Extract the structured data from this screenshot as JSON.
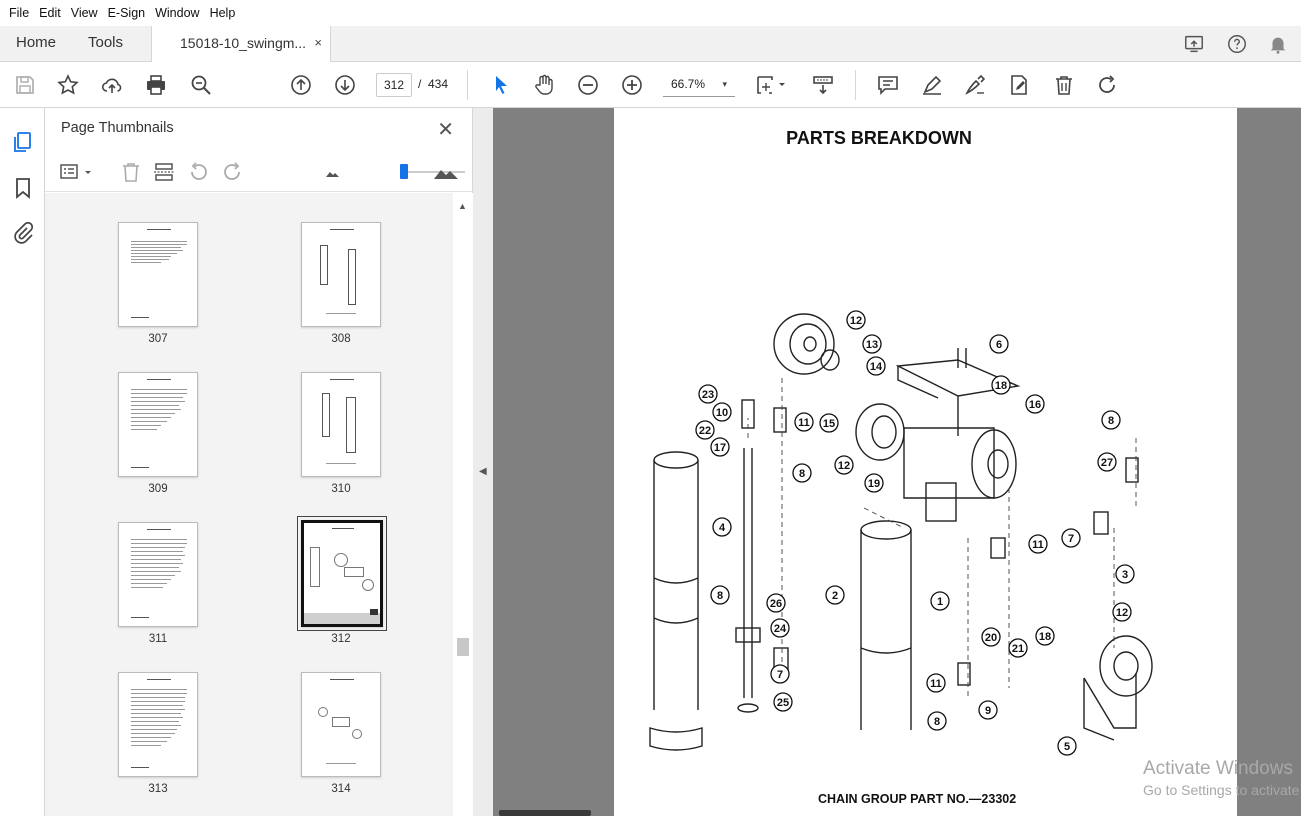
{
  "menu": [
    "File",
    "Edit",
    "View",
    "E-Sign",
    "Window",
    "Help"
  ],
  "tabs": {
    "home": "Home",
    "tools": "Tools",
    "document": "15018-10_swingm...",
    "close": "×"
  },
  "toolbar": {
    "page_current": "312",
    "page_sep": "/",
    "page_total": "434",
    "zoom": "66.7%",
    "zoom_arrow": "▾"
  },
  "panel": {
    "title": "Page Thumbnails",
    "close": "✕",
    "scroll_up": "▲"
  },
  "thumbnails": [
    {
      "label": "307"
    },
    {
      "label": "308"
    },
    {
      "label": "309"
    },
    {
      "label": "310"
    },
    {
      "label": "311"
    },
    {
      "label": "312",
      "selected": true
    },
    {
      "label": "313"
    },
    {
      "label": "314"
    }
  ],
  "collapse_arrow": "◀",
  "document": {
    "title": "PARTS BREAKDOWN",
    "caption": "CHAIN GROUP PART NO.—23302",
    "callouts": [
      "1",
      "2",
      "3",
      "4",
      "5",
      "6",
      "7",
      "7",
      "7",
      "8",
      "8",
      "8",
      "8",
      "9",
      "10",
      "11",
      "11",
      "11",
      "11",
      "12",
      "12",
      "12",
      "13",
      "14",
      "15",
      "16",
      "17",
      "18",
      "18",
      "19",
      "20",
      "21",
      "22",
      "23",
      "24",
      "25",
      "26",
      "27"
    ]
  },
  "watermark": {
    "line1": "Activate Windows",
    "line2": "Go to Settings to activate Windows."
  },
  "colors": {
    "accent": "#1473e6",
    "docbg": "#808080",
    "panelbg": "#f3f3f3"
  }
}
